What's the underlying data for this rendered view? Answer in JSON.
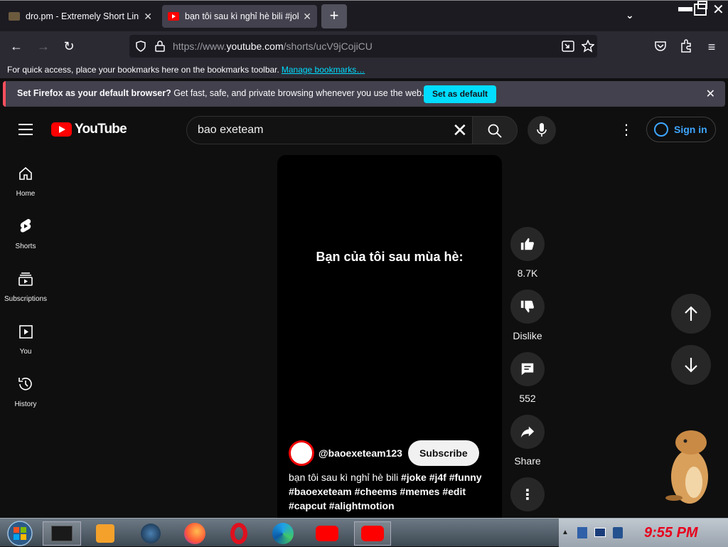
{
  "browser": {
    "tabs": [
      {
        "title": "dro.pm - Extremely Short Links",
        "active": false
      },
      {
        "title": "bạn tôi sau kì nghỉ hè bili #jok",
        "active": true
      }
    ],
    "url": {
      "prefix": "https://www.",
      "domain": "youtube.com",
      "path": "/shorts/ucV9jCojiCU"
    },
    "bookmarks_hint": "For quick access, place your bookmarks here on the bookmarks toolbar.",
    "bookmarks_link": "Manage bookmarks…",
    "notification": {
      "bold": "Set Firefox as your default browser?",
      "text": "Get fast, safe, and private browsing whenever you use the web.",
      "button": "Set as default"
    }
  },
  "youtube": {
    "logo_text": "YouTube",
    "search_value": "bao exeteam",
    "signin_label": "Sign in",
    "sidebar": [
      {
        "label": "Home",
        "icon": "home-icon"
      },
      {
        "label": "Shorts",
        "icon": "shorts-icon"
      },
      {
        "label": "Subscriptions",
        "icon": "subscriptions-icon"
      },
      {
        "label": "You",
        "icon": "you-icon"
      },
      {
        "label": "History",
        "icon": "history-icon"
      }
    ],
    "video": {
      "caption": "Bạn của tôi sau mùa hè:",
      "channel": "@baoexeteam123",
      "subscribe_label": "Subscribe",
      "description_plain": "bạn tôi sau kì nghỉ hè bili",
      "hashtags_line1": "#joke #j4f #funny",
      "hashtags_line2": "#baoexeteam #cheems #memes #edit",
      "hashtags_line3": "#capcut #alightmotion"
    },
    "actions": {
      "likes": "8.7K",
      "dislike_label": "Dislike",
      "comments": "552",
      "share_label": "Share"
    }
  },
  "taskbar": {
    "clock": "9:55 PM"
  }
}
